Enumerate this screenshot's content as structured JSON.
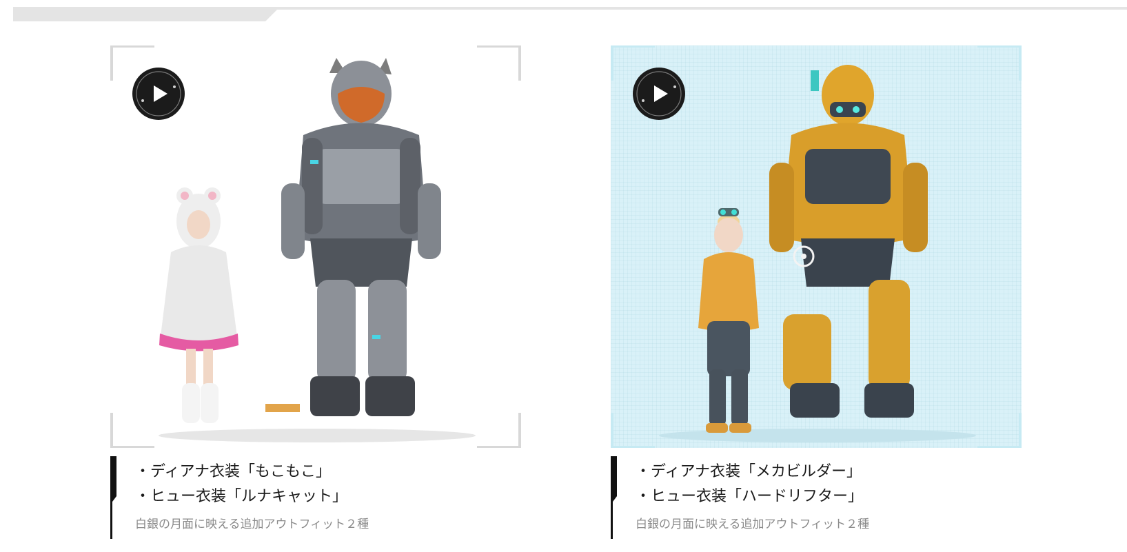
{
  "colors": {
    "accent_dark": "#111111",
    "card2_background": "#d9f1f8",
    "caption_sub": "#8a8a8a"
  },
  "cards": [
    {
      "play_icon": "play-circle-icon",
      "line1": "・ディアナ衣装「もこもこ」",
      "line2": "・ヒュー衣装「ルナキャット」",
      "sub": "白銀の月面に映える追加アウトフィット２種"
    },
    {
      "play_icon": "play-circle-icon",
      "line1": "・ディアナ衣装「メカビルダー」",
      "line2": "・ヒュー衣装「ハードリフター」",
      "sub": "白銀の月面に映える追加アウトフィット２種"
    }
  ]
}
